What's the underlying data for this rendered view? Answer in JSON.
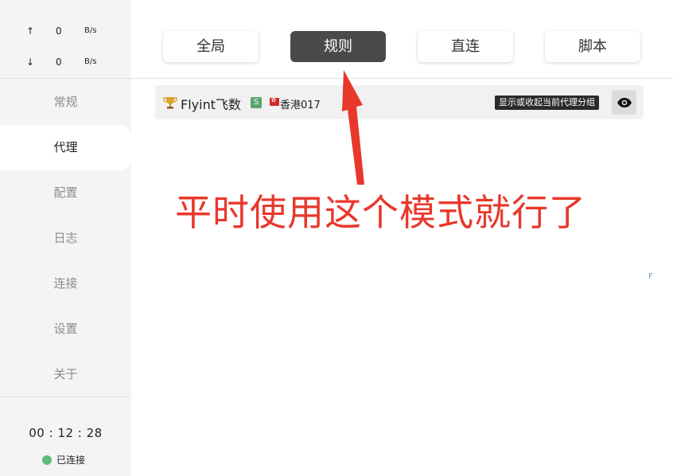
{
  "traffic": {
    "upload": {
      "arrow": "↑",
      "value": "0",
      "unit": "B/s"
    },
    "download": {
      "arrow": "↓",
      "value": "0",
      "unit": "B/s"
    }
  },
  "nav": [
    {
      "label": "常规"
    },
    {
      "label": "代理"
    },
    {
      "label": "配置"
    },
    {
      "label": "日志"
    },
    {
      "label": "连接"
    },
    {
      "label": "设置"
    },
    {
      "label": "关于"
    }
  ],
  "timer": "00 : 12 : 28",
  "connection_status": "已连接",
  "modes": [
    {
      "label": "全局"
    },
    {
      "label": "规则"
    },
    {
      "label": "直连"
    },
    {
      "label": "脚本"
    }
  ],
  "proxy_group": {
    "name": "Flyint飞数",
    "type_badge": "S",
    "selected_node": "香港017",
    "tooltip": "显示或收起当前代理分组"
  },
  "annotation": "平时使用这个模式就行了",
  "stray_text": "F",
  "colors": {
    "accent_active": "#4a4a4a",
    "annotation_red": "#e8372b",
    "status_green": "#5cbf7b",
    "sidebar_bg": "#f4f4f4"
  }
}
